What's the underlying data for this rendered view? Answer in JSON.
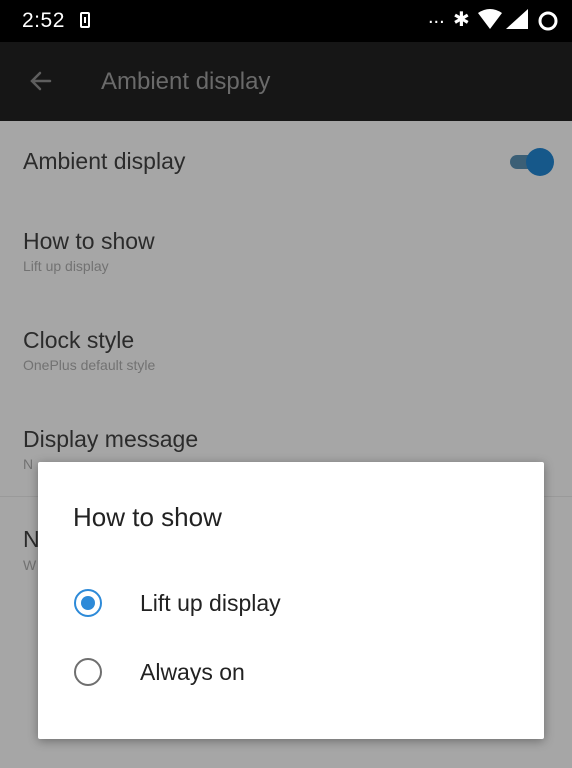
{
  "status_bar": {
    "time": "2:52",
    "overflow_dots": "...",
    "icons": [
      "sim-card-icon",
      "bluetooth-icon",
      "wifi-icon",
      "signal-icon",
      "battery-icon"
    ]
  },
  "toolbar": {
    "title": "Ambient display",
    "back_icon": "back-arrow-icon"
  },
  "settings": [
    {
      "title": "Ambient display",
      "subtitle": "",
      "toggle_on": true
    },
    {
      "title": "How to show",
      "subtitle": "Lift up display"
    },
    {
      "title": "Clock style",
      "subtitle": "OnePlus default style"
    },
    {
      "title": "Display message",
      "subtitle": "N"
    },
    {
      "title": "N",
      "subtitle": "W"
    }
  ],
  "dialog": {
    "title": "How to show",
    "options": [
      {
        "label": "Lift up display",
        "selected": true
      },
      {
        "label": "Always on",
        "selected": false
      }
    ]
  },
  "colors": {
    "accent": "#2d8ad8",
    "scrim_background": "#a6a6a6",
    "status_bar": "#000000"
  }
}
